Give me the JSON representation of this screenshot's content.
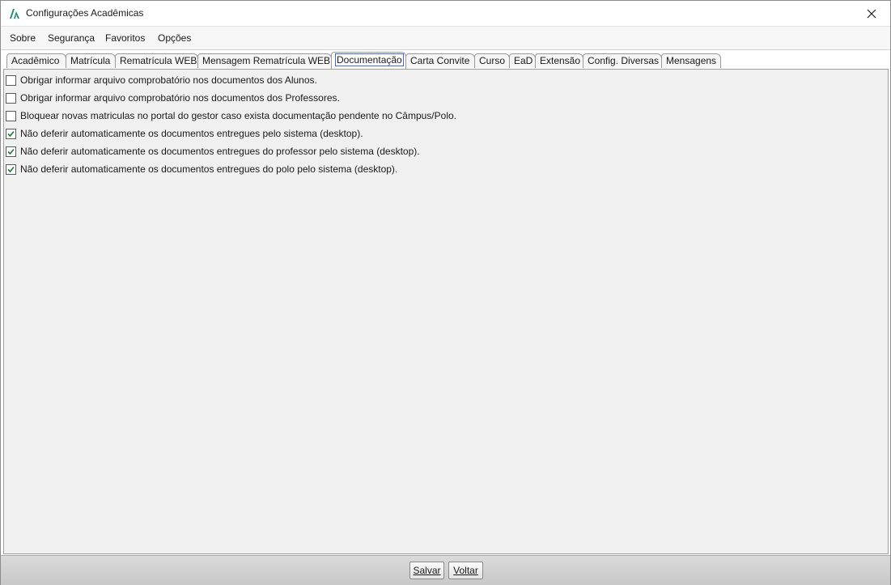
{
  "window": {
    "title": "Configurações Acadêmicas"
  },
  "menu": [
    "Sobre",
    "Segurança",
    "Favoritos",
    "Opções"
  ],
  "tabs": [
    {
      "label": "Acadêmico"
    },
    {
      "label": "Matrícula"
    },
    {
      "label": "Rematrícula WEB"
    },
    {
      "label": "Mensagem Rematrícula WEB"
    },
    {
      "label": "Documentação",
      "active": true
    },
    {
      "label": "Carta Convite"
    },
    {
      "label": "Curso"
    },
    {
      "label": "EaD"
    },
    {
      "label": "Extensão"
    },
    {
      "label": "Config. Diversas"
    },
    {
      "label": "Mensagens"
    }
  ],
  "options": [
    {
      "label": "Obrigar informar arquivo comprobatório nos documentos dos Alunos.",
      "checked": false
    },
    {
      "label": "Obrigar informar arquivo comprobatório nos documentos dos Professores.",
      "checked": false
    },
    {
      "label": "Bloquear novas matriculas no portal do gestor caso exista documentação pendente no Câmpus/Polo.",
      "checked": false
    },
    {
      "label": "Não deferir automaticamente os documentos entregues pelo sistema (desktop).",
      "checked": true
    },
    {
      "label": "Não deferir automaticamente os documentos entregues do professor pelo sistema (desktop).",
      "checked": true
    },
    {
      "label": "Não deferir automaticamente os documentos entregues do polo pelo sistema (desktop).",
      "checked": true
    }
  ],
  "footer": {
    "save_label": "Salvar",
    "back_label": "Voltar"
  },
  "colors": {
    "logo": "#1f8a78",
    "check": "#1f7a3a",
    "focus": "#3d6dcc"
  }
}
